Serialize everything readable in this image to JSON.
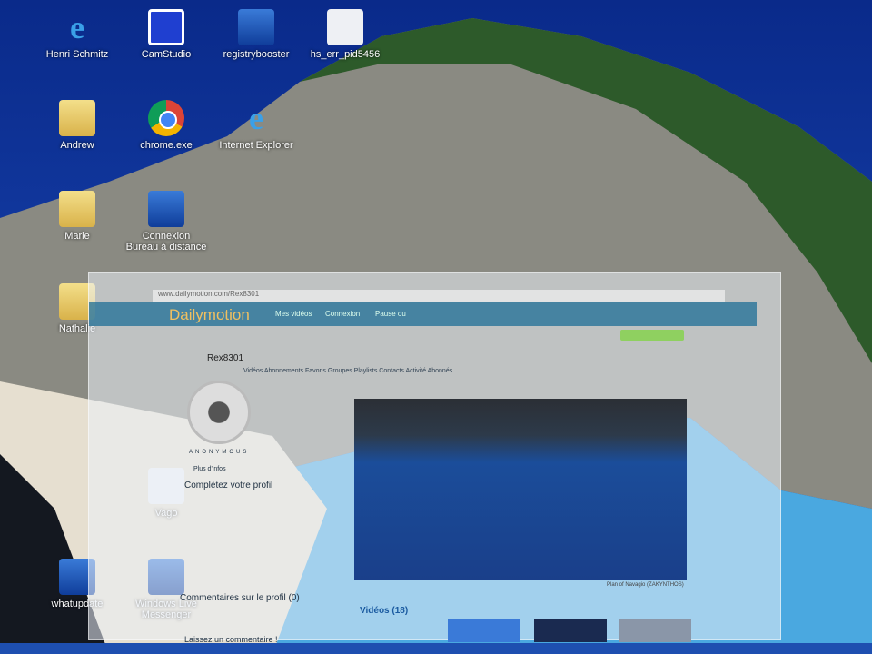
{
  "desktop": {
    "icons": [
      {
        "label": "Henri Schmitz",
        "type": "ie"
      },
      {
        "label": "CamStudio",
        "type": "cam"
      },
      {
        "label": "registrybooster",
        "type": "blue"
      },
      {
        "label": "hs_err_pid5456",
        "type": "file"
      },
      {
        "label": "Andrew",
        "type": "folder"
      },
      {
        "label": "chrome.exe",
        "type": "chrome"
      },
      {
        "label": "Internet Explorer",
        "type": "ie"
      },
      {
        "label": "Marie",
        "type": "folder"
      },
      {
        "label": "Connexion Bureau à distance",
        "type": "blue"
      },
      {
        "label": "Nathalie",
        "type": "folder"
      },
      {
        "label": "Vago",
        "type": "file"
      },
      {
        "label": "whatupdate",
        "type": "blue"
      },
      {
        "label": "Windows Live Messenger",
        "type": "blue"
      }
    ]
  },
  "browser": {
    "address": "www.dailymotion.com/Rex8301",
    "logo": "Dailymotion",
    "nav": [
      "Mes vidéos",
      "Connexion",
      "Pause ou"
    ],
    "username": "Rex8301",
    "tabs": "Vidéos  Abonnements  Favoris  Groupes  Playlists  Contacts  Activité  Abonnés",
    "avatar_caption": "ANONYMOUS",
    "more_info": "Plus d'infos",
    "complete_profile": "Complétez votre profil",
    "profile_comments": "Commentaires sur le profil (0)",
    "leave_comment": "Laissez un commentaire !",
    "videos_heading": "Vidéos (18)",
    "video_caption": "Plan of Navagio (ZAKYNTHOS)"
  }
}
